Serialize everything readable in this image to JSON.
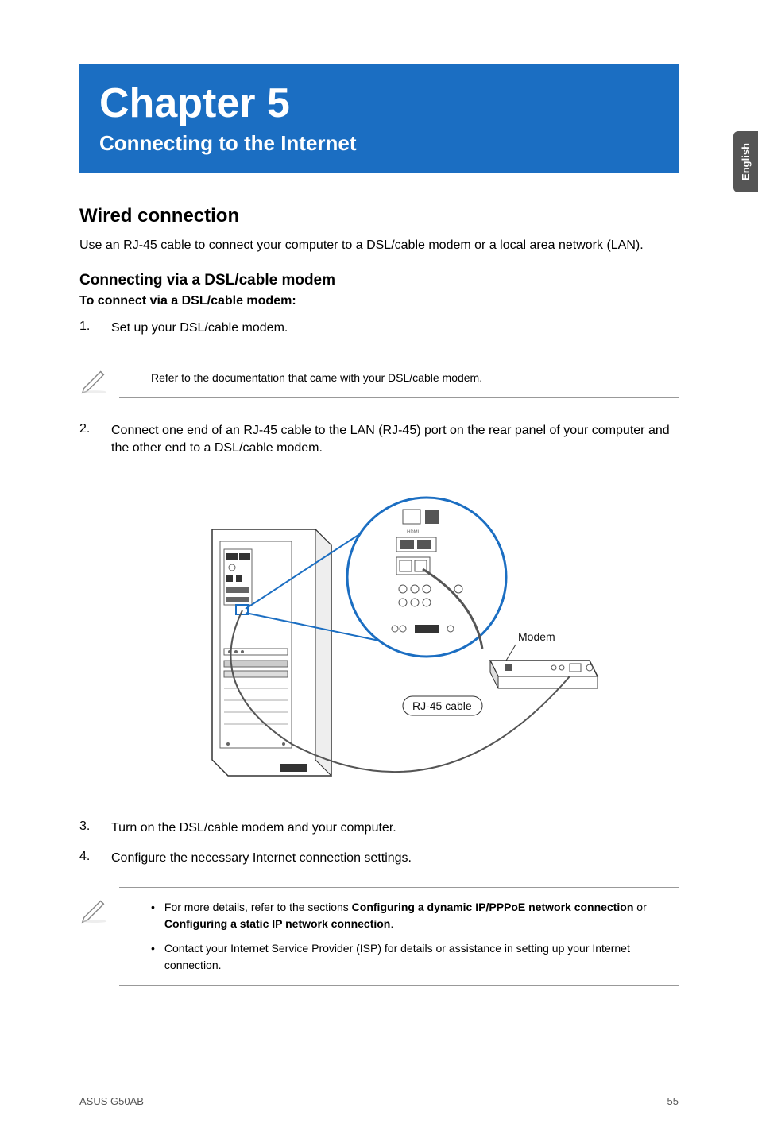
{
  "sidebar_tab": "English",
  "chapter": {
    "title": "Chapter 5",
    "subtitle": "Connecting to the Internet"
  },
  "section": {
    "title": "Wired connection",
    "intro": "Use an RJ-45 cable to connect your computer to a DSL/cable modem or a local area network (LAN).",
    "subsection_title": "Connecting via a DSL/cable modem",
    "instruction_heading": "To connect via a DSL/cable modem:",
    "steps": [
      {
        "num": "1.",
        "text": "Set up your DSL/cable modem."
      },
      {
        "num": "2.",
        "text": "Connect one end of an RJ-45 cable to the LAN (RJ-45) port on the rear panel of your computer and the other end to a DSL/cable modem."
      },
      {
        "num": "3.",
        "text": "Turn on the DSL/cable modem and your computer."
      },
      {
        "num": "4.",
        "text": "Configure the necessary Internet connection settings."
      }
    ]
  },
  "note1": {
    "text": "Refer to the documentation that came with your DSL/cable modem."
  },
  "note2": {
    "bullets": [
      {
        "prefix": "For more details, refer to the sections ",
        "bold1": "Configuring a dynamic IP/PPPoE network connection",
        "mid": " or ",
        "bold2": "Configuring a static IP network connection",
        "suffix": "."
      },
      {
        "text": "Contact your Internet Service Provider (ISP) for details or assistance in setting up your Internet connection."
      }
    ]
  },
  "diagram": {
    "modem_label": "Modem",
    "cable_label": "RJ-45 cable"
  },
  "footer": {
    "left": "ASUS G50AB",
    "right": "55"
  }
}
